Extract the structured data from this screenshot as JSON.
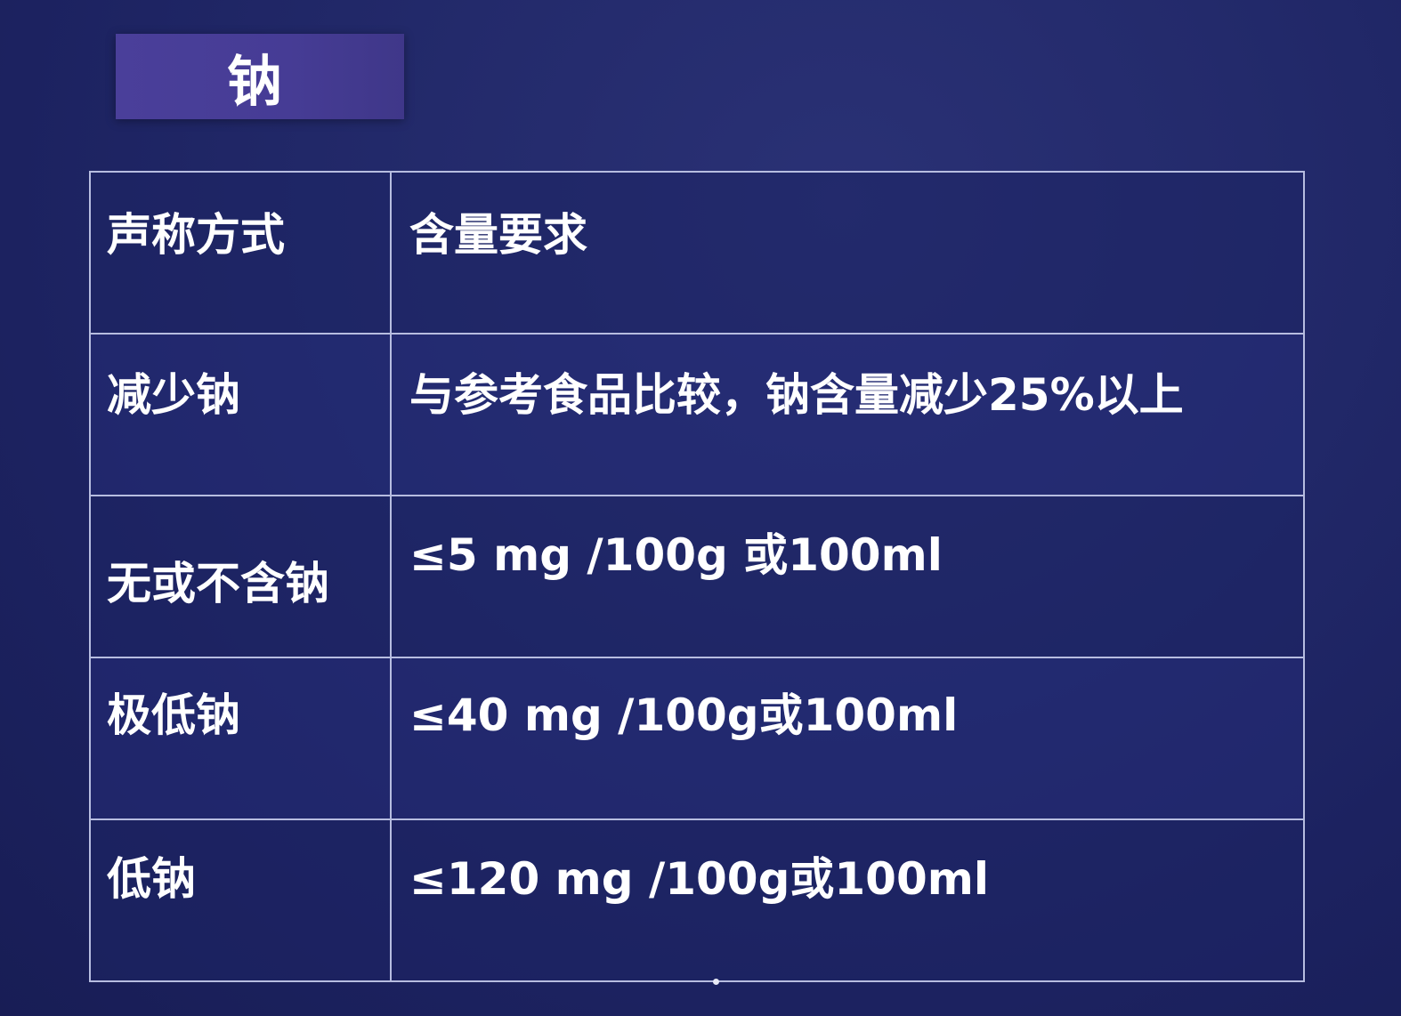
{
  "slide": {
    "title": "钠"
  },
  "table": {
    "rows": [
      {
        "claim": "声称方式",
        "requirement": "含量要求"
      },
      {
        "claim": "减少钠",
        "requirement": "与参考食品比较，钠含量减少25%以上"
      },
      {
        "claim": "无或不含钠",
        "requirement": "≤5 mg /100g 或100ml"
      },
      {
        "claim": "极低钠",
        "requirement": "≤40 mg /100g或100ml"
      },
      {
        "claim": "低钠",
        "requirement": "≤120 mg /100g或100ml"
      }
    ]
  },
  "colors": {
    "background": "#1f2565",
    "title_box": "#463c95",
    "border": "#b7bde0",
    "text": "#ffffff"
  }
}
